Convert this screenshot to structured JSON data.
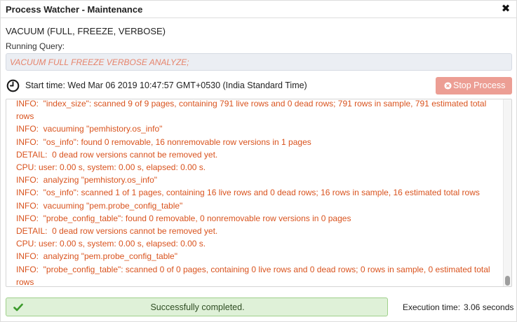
{
  "window": {
    "title": "Process Watcher - Maintenance",
    "close_glyph": "✖"
  },
  "process": {
    "command": "VACUUM (FULL, FREEZE, VERBOSE)",
    "running_query_label": "Running Query:",
    "running_query": "VACUUM FULL FREEZE VERBOSE ANALYZE;",
    "start_time": "Start time: Wed Mar 06 2019 10:47:57 GMT+0530 (India Standard Time)",
    "stop_button_label": "Stop Process"
  },
  "log": {
    "lines": [
      "INFO:  \"index_size\": scanned 9 of 9 pages, containing 791 live rows and 0 dead rows; 791 rows in sample, 791 estimated total rows",
      "INFO:  vacuuming \"pemhistory.os_info\"",
      "INFO:  \"os_info\": found 0 removable, 16 nonremovable row versions in 1 pages",
      "DETAIL:  0 dead row versions cannot be removed yet.",
      "CPU: user: 0.00 s, system: 0.00 s, elapsed: 0.00 s.",
      "INFO:  analyzing \"pemhistory.os_info\"",
      "INFO:  \"os_info\": scanned 1 of 1 pages, containing 16 live rows and 0 dead rows; 16 rows in sample, 16 estimated total rows",
      "INFO:  vacuuming \"pem.probe_config_table\"",
      "INFO:  \"probe_config_table\": found 0 removable, 0 nonremovable row versions in 0 pages",
      "DETAIL:  0 dead row versions cannot be removed yet.",
      "CPU: user: 0.00 s, system: 0.00 s, elapsed: 0.00 s.",
      "INFO:  analyzing \"pem.probe_config_table\"",
      "INFO:  \"probe_config_table\": scanned 0 of 0 pages, containing 0 live rows and 0 dead rows; 0 rows in sample, 0 estimated total rows"
    ]
  },
  "status": {
    "message": "Successfully completed.",
    "execution_time_label": "Execution time:",
    "execution_time_value": "3.06 seconds"
  },
  "colors": {
    "log_text": "#d9531e",
    "query_text": "#e6836b",
    "stop_button": "#ec9e94",
    "success_bg": "#dff1d8",
    "success_border": "#9fd08a",
    "success_icon": "#3c9a2c"
  },
  "icons": {
    "close": "close-icon",
    "clock": "clock-icon",
    "stop": "times-circle-icon",
    "success": "check-icon"
  }
}
